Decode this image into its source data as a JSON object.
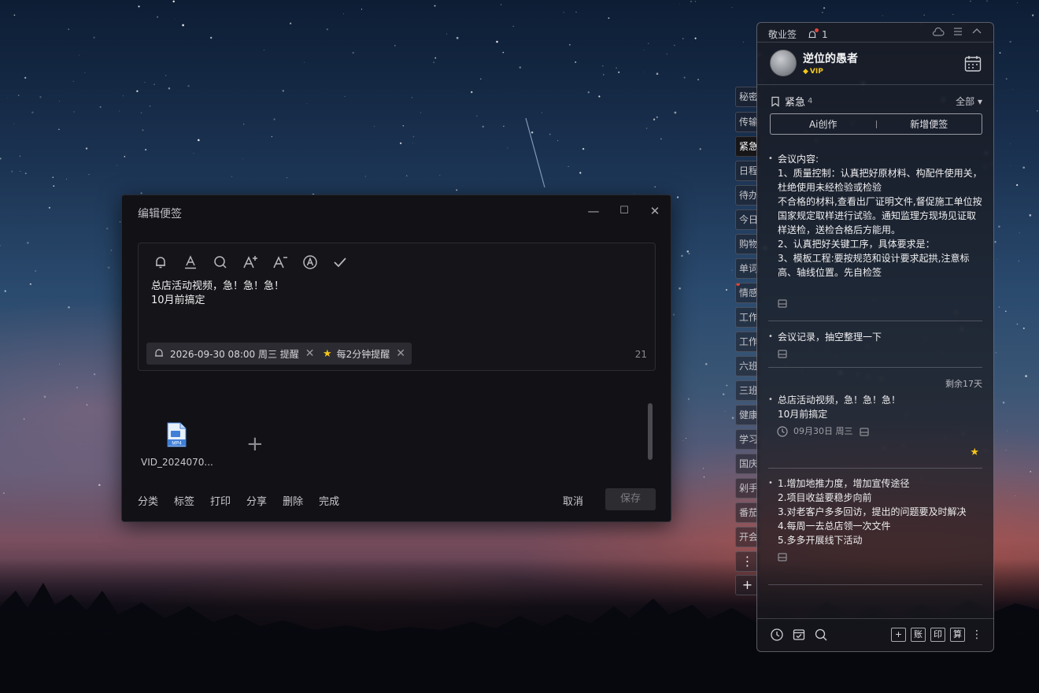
{
  "edit_window": {
    "title": "编辑便签",
    "controls": {
      "minimize": "—",
      "maximize": "☐",
      "close": "✕"
    },
    "toolbar": [
      "bell-icon",
      "text-color-icon",
      "search-icon",
      "font-increase-icon",
      "font-decrease-icon",
      "text-style-icon",
      "check-icon"
    ],
    "note_text": [
      "总店活动视频，急！急！急！",
      "10月前搞定"
    ],
    "tags": {
      "reminder": "2026-09-30 08:00 周三 提醒",
      "repeat": "每2分钟提醒"
    },
    "char_count": "21",
    "attachment": {
      "badge": "MP4",
      "name": "VID_2024070..."
    },
    "add_symbol": "+",
    "actions": [
      "分类",
      "标签",
      "打印",
      "分享",
      "删除",
      "完成"
    ],
    "cancel": "取消",
    "save": "保存"
  },
  "side_tabs": [
    "秘密",
    "传输",
    "紧急",
    "日程",
    "待办",
    "今日",
    "购物",
    "单词",
    "情感",
    "工作",
    "工作",
    "六班",
    "三班",
    "健康",
    "学习",
    "国庆",
    "剁手",
    "番茄",
    "开会"
  ],
  "side_tab_more": "⋮",
  "side_tab_add": "+",
  "panel": {
    "app_name": "敬业签",
    "notification_count": "1",
    "user": {
      "name": "逆位的愚者",
      "badge": "VIP"
    },
    "category": {
      "name": "紧急",
      "count": "4",
      "filter": "全部 ▾"
    },
    "ai_create": "Ai创作",
    "new_note": "新增便签",
    "notes": [
      {
        "text": "会议内容:\n1、质量控制：认真把好原材料、构配件使用关，杜绝使用未经检验或检验\n不合格的材料,查看出厂证明文件,督促施工单位按国家规定取样进行试验。通知监理方现场见证取样送检，送检合格后方能用。\n2、认真把好关键工序，具体要求是：\n3、模板工程:要按规范和设计要求起拱,注意标高、轴线位置。先自检签"
      },
      {
        "text": "会议记录，抽空整理一下"
      },
      {
        "remaining": "剩余17天",
        "text": "总店活动视频，急！急！急！\n10月前搞定",
        "date": "09月30日 周三"
      },
      {
        "text": "1.增加地推力度，增加宣传途径\n2.项目收益要稳步向前\n3.对老客户多多回访，提出的问题要及时解决\n4.每周一去总店领一次文件\n5.多多开展线下活动"
      }
    ],
    "bottom_right_buttons": [
      "+",
      "账",
      "印",
      "算"
    ],
    "bottom_more": "⋮"
  },
  "colors": {
    "accent_red": "#e0463b",
    "star_yellow": "#f5c518",
    "window_bg": "#111116"
  }
}
